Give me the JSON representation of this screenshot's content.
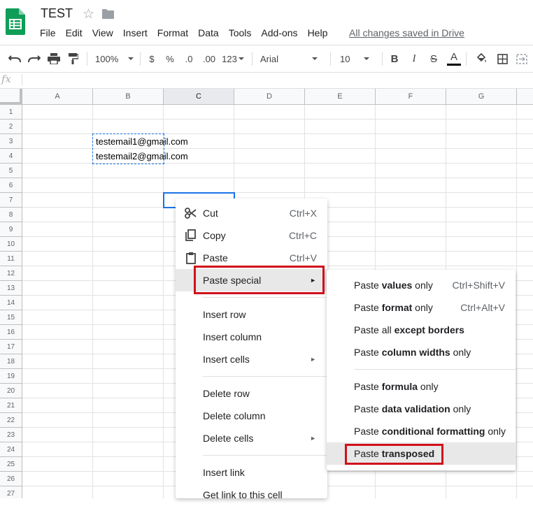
{
  "app": {
    "title": "TEST",
    "menus": [
      "File",
      "Edit",
      "View",
      "Insert",
      "Format",
      "Data",
      "Tools",
      "Add-ons",
      "Help"
    ],
    "save_status": "All changes saved in Drive"
  },
  "toolbar": {
    "zoom": "100%",
    "currency": "$",
    "percent": "%",
    "decrease_decimal": ".0",
    "increase_decimal": ".00",
    "more_formats": "123",
    "font": "Arial",
    "font_size": "10",
    "bold": "B",
    "italic": "I",
    "strikethrough": "S",
    "text_color": "A"
  },
  "formula_bar": {
    "fx": "fx"
  },
  "sheet": {
    "columns": [
      "A",
      "B",
      "C",
      "D",
      "E",
      "F",
      "G"
    ],
    "selected_column": "C",
    "rows": [
      "1",
      "2",
      "3",
      "4",
      "5",
      "6",
      "7",
      "8",
      "9",
      "10",
      "11",
      "12",
      "13",
      "14",
      "15",
      "16",
      "17",
      "18",
      "19",
      "20",
      "21",
      "22",
      "23",
      "24",
      "25",
      "26",
      "27"
    ],
    "cells": {
      "B3": "testemail1@gmail.com",
      "B4": "testemail2@gmail.com"
    }
  },
  "context_menu": {
    "cut": {
      "label": "Cut",
      "shortcut": "Ctrl+X"
    },
    "copy": {
      "label": "Copy",
      "shortcut": "Ctrl+C"
    },
    "paste": {
      "label": "Paste",
      "shortcut": "Ctrl+V"
    },
    "paste_special": {
      "label": "Paste special"
    },
    "insert_row": "Insert row",
    "insert_column": "Insert column",
    "insert_cells": "Insert cells",
    "delete_row": "Delete row",
    "delete_column": "Delete column",
    "delete_cells": "Delete cells",
    "insert_link": "Insert link",
    "get_link": "Get link to this cell"
  },
  "paste_special_menu": {
    "values": {
      "pre": "Paste ",
      "bold": "values",
      "post": " only",
      "shortcut": "Ctrl+Shift+V"
    },
    "format": {
      "pre": "Paste ",
      "bold": "format",
      "post": " only",
      "shortcut": "Ctrl+Alt+V"
    },
    "all_except_borders": {
      "pre": "Paste all ",
      "bold": "except borders",
      "post": ""
    },
    "column_widths": {
      "pre": "Paste ",
      "bold": "column widths",
      "post": " only"
    },
    "formula": {
      "pre": "Paste ",
      "bold": "formula",
      "post": " only"
    },
    "data_validation": {
      "pre": "Paste ",
      "bold": "data validation",
      "post": " only"
    },
    "conditional_formatting": {
      "pre": "Paste ",
      "bold": "conditional formatting",
      "post": " only"
    },
    "transposed": {
      "pre": "Paste ",
      "bold": "transposed",
      "post": ""
    }
  },
  "colors": {
    "highlight_border": "#d0111b",
    "selection": "#1a73e8",
    "sheets_green": "#0f9d58"
  },
  "icons": [
    "sheets-logo-icon",
    "star-icon",
    "folder-icon",
    "undo-icon",
    "redo-icon",
    "print-icon",
    "paint-format-icon",
    "fill-color-icon",
    "borders-icon",
    "merge-icon",
    "cut-icon",
    "copy-icon",
    "paste-icon"
  ]
}
